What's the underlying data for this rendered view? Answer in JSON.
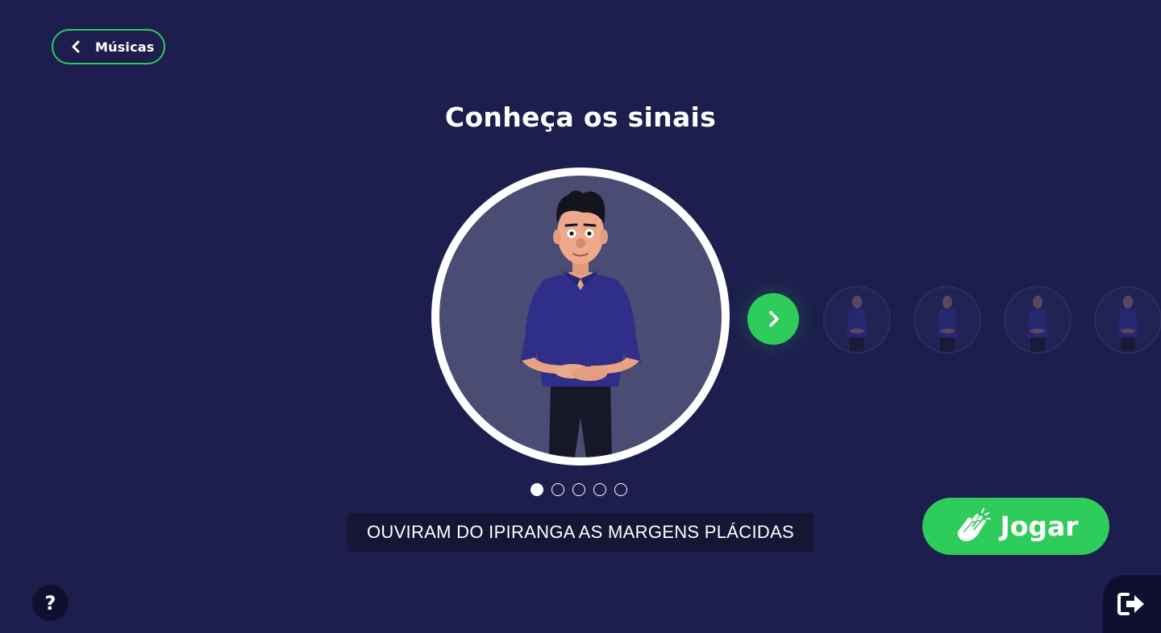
{
  "header": {
    "back_label": "Músicas",
    "title": "Conheça os sinais"
  },
  "carousel": {
    "pages": 5,
    "current_page": 1,
    "caption": "OUVIRAM DO IPIRANGA AS MARGENS PLÁCIDAS"
  },
  "actions": {
    "play_label": "Jogar",
    "help_label": "?"
  },
  "icons": {
    "back": "chevron-left-icon",
    "next": "chevron-right-icon",
    "play": "clapping-hands-icon",
    "exit": "sign-out-icon"
  },
  "colors": {
    "background": "#1d1e4d",
    "accent_green": "#2ecc5a",
    "caption_bg": "#141634",
    "avatar_bg": "#4b4c73"
  }
}
